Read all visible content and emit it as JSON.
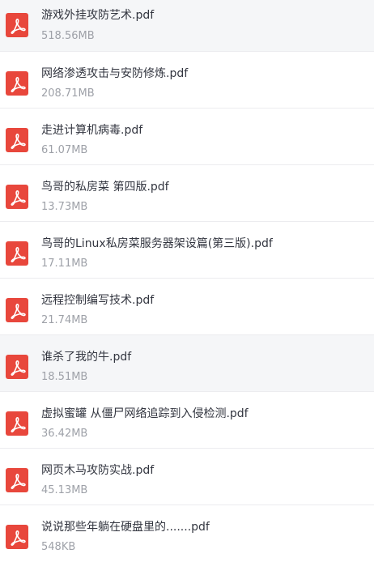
{
  "files": [
    {
      "name": "游戏外挂攻防艺术.pdf",
      "size": "518.56MB",
      "icon": "pdf-file-icon",
      "highlight": true
    },
    {
      "name": "网络渗透攻击与安防修炼.pdf",
      "size": "208.71MB",
      "icon": "pdf-file-icon",
      "highlight": false
    },
    {
      "name": "走进计算机病毒.pdf",
      "size": "61.07MB",
      "icon": "pdf-file-icon",
      "highlight": false
    },
    {
      "name": "鸟哥的私房菜 第四版.pdf",
      "size": "13.73MB",
      "icon": "pdf-file-icon",
      "highlight": false
    },
    {
      "name": "鸟哥的Linux私房菜服务器架设篇(第三版).pdf",
      "size": "17.11MB",
      "icon": "pdf-file-icon",
      "highlight": false
    },
    {
      "name": "远程控制编写技术.pdf",
      "size": "21.74MB",
      "icon": "pdf-file-icon",
      "highlight": false
    },
    {
      "name": "谁杀了我的牛.pdf",
      "size": "18.51MB",
      "icon": "pdf-file-icon",
      "highlight": true
    },
    {
      "name": "虚拟蜜罐 从僵尸网络追踪到入侵检测.pdf",
      "size": "36.42MB",
      "icon": "pdf-file-icon",
      "highlight": false
    },
    {
      "name": "网页木马攻防实战.pdf",
      "size": "45.13MB",
      "icon": "pdf-file-icon",
      "highlight": false
    },
    {
      "name": "说说那些年躺在硬盘里的.......pdf",
      "size": "548KB",
      "icon": "pdf-file-icon",
      "highlight": false
    }
  ],
  "colors": {
    "pdf_icon": "#e8473c",
    "name_text": "#333640",
    "size_text": "#9ea1a8",
    "highlight_bg": "#f5f6f8",
    "divider": "#ececef"
  }
}
